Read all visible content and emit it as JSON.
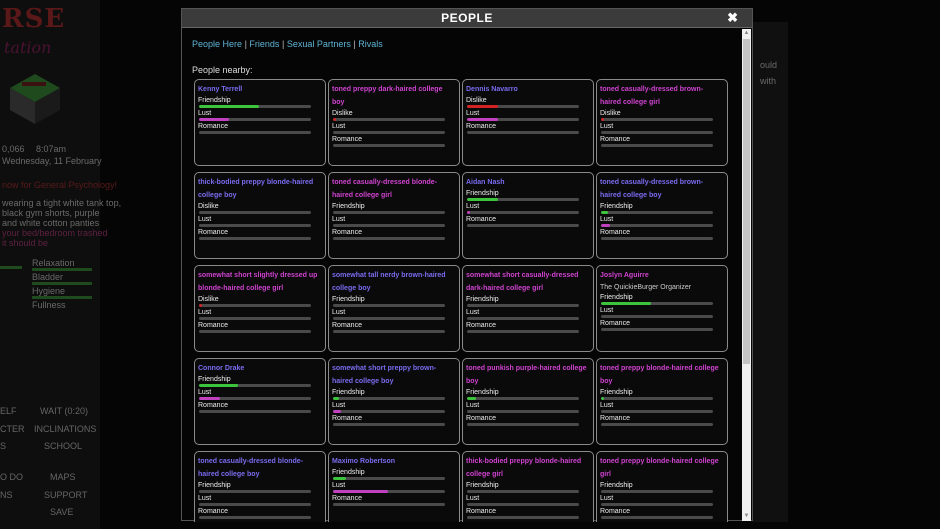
{
  "background": {
    "game_title": "RSE",
    "game_subtitle": "tation",
    "stats_left": [
      "0,066",
      "8:07am",
      "Wednesday, 11 February"
    ],
    "class_text": "now for General Psychology!",
    "outfit_text": [
      "wearing a tight white tank top,",
      "black gym shorts, purple",
      "and white cotton panties"
    ],
    "pink_text": [
      "your bed/bedroom trashed",
      "it should be"
    ],
    "side_labels": [
      "Relaxation",
      "Bladder",
      "Hygiene",
      "Fullness"
    ],
    "menu_items": [
      "ELF",
      "WAIT (0:20)",
      "CTER",
      "INCLINATIONS",
      "S",
      "SCHOOL",
      "O DO",
      "MAPS",
      "NS",
      "SUPPORT",
      "SAVE"
    ],
    "right_text": [
      "ould",
      "with"
    ]
  },
  "modal": {
    "title": "PEOPLE",
    "close_label": "✖",
    "tabs": [
      "People Here",
      "Friends",
      "Sexual Partners",
      "Rivals"
    ],
    "tab_separator": "|",
    "nearby_label": "People nearby:"
  },
  "colors": {
    "friendship": "#3cc43c",
    "dislike": "#d22222",
    "lust": "#c040c0",
    "romance": "#9a9a9a",
    "male_name": "#7a6cf0",
    "female_name": "#d043d0",
    "link": "#5fb4d6"
  },
  "people": [
    {
      "name": "Kenny Terrell",
      "gender": "m",
      "stats": [
        {
          "label": "Friendship",
          "type": "friendship",
          "value": 0.54
        },
        {
          "label": "Lust",
          "type": "lust",
          "value": 0.27
        },
        {
          "label": "Romance",
          "type": "romance",
          "value": 0
        }
      ]
    },
    {
      "name": "toned preppy dark-haired college boy",
      "gender": "f",
      "stats": [
        {
          "label": "Dislike",
          "type": "dislike",
          "value": 0.03
        },
        {
          "label": "Lust",
          "type": "lust",
          "value": 0
        },
        {
          "label": "Romance",
          "type": "romance",
          "value": 0
        }
      ]
    },
    {
      "name": "Dennis Navarro",
      "gender": "m",
      "stats": [
        {
          "label": "Dislike",
          "type": "dislike",
          "value": 0.28
        },
        {
          "label": "Lust",
          "type": "lust",
          "value": 0.28
        },
        {
          "label": "Romance",
          "type": "romance",
          "value": 0
        }
      ]
    },
    {
      "name": "toned casually-dressed brown-haired college girl",
      "gender": "f",
      "stats": [
        {
          "label": "Dislike",
          "type": "dislike",
          "value": 0.03
        },
        {
          "label": "Lust",
          "type": "lust",
          "value": 0
        },
        {
          "label": "Romance",
          "type": "romance",
          "value": 0
        }
      ]
    },
    {
      "name": "thick-bodied preppy blonde-haired college boy",
      "gender": "m",
      "stats": [
        {
          "label": "Dislike",
          "type": "dislike",
          "value": 0
        },
        {
          "label": "Lust",
          "type": "lust",
          "value": 0
        },
        {
          "label": "Romance",
          "type": "romance",
          "value": 0
        }
      ]
    },
    {
      "name": "toned casually-dressed blonde-haired college girl",
      "gender": "f",
      "stats": [
        {
          "label": "Friendship",
          "type": "friendship",
          "value": 0
        },
        {
          "label": "Lust",
          "type": "lust",
          "value": 0
        },
        {
          "label": "Romance",
          "type": "romance",
          "value": 0
        }
      ]
    },
    {
      "name": "Aidan Nash",
      "gender": "m",
      "stats": [
        {
          "label": "Friendship",
          "type": "friendship",
          "value": 0.28
        },
        {
          "label": "Lust",
          "type": "lust",
          "value": 0.03
        },
        {
          "label": "Romance",
          "type": "romance",
          "value": 0
        }
      ]
    },
    {
      "name": "toned casually-dressed brown-haired college boy",
      "gender": "m",
      "stats": [
        {
          "label": "Friendship",
          "type": "friendship",
          "value": 0.06
        },
        {
          "label": "Lust",
          "type": "lust",
          "value": 0.08
        },
        {
          "label": "Romance",
          "type": "romance",
          "value": 0
        }
      ]
    },
    {
      "name": "somewhat short slightly dressed up blonde-haired college girl",
      "gender": "f",
      "stats": [
        {
          "label": "Dislike",
          "type": "dislike",
          "value": 0.03
        },
        {
          "label": "Lust",
          "type": "lust",
          "value": 0
        },
        {
          "label": "Romance",
          "type": "romance",
          "value": 0
        }
      ]
    },
    {
      "name": "somewhat tall nerdy brown-haired college boy",
      "gender": "m",
      "stats": [
        {
          "label": "Friendship",
          "type": "friendship",
          "value": 0
        },
        {
          "label": "Lust",
          "type": "lust",
          "value": 0
        },
        {
          "label": "Romance",
          "type": "romance",
          "value": 0
        }
      ]
    },
    {
      "name": "somewhat short casually-dressed dark-haired college girl",
      "gender": "f",
      "stats": [
        {
          "label": "Friendship",
          "type": "friendship",
          "value": 0
        },
        {
          "label": "Lust",
          "type": "lust",
          "value": 0
        },
        {
          "label": "Romance",
          "type": "romance",
          "value": 0
        }
      ]
    },
    {
      "name": "Joslyn Aguirre",
      "gender": "f",
      "job": "The QuickieBurger Organizer",
      "stats": [
        {
          "label": "Friendship",
          "type": "friendship",
          "value": 0.45
        },
        {
          "label": "Lust",
          "type": "lust",
          "value": 0
        },
        {
          "label": "Romance",
          "type": "romance",
          "value": 0
        }
      ]
    },
    {
      "name": "Connor Drake",
      "gender": "m",
      "stats": [
        {
          "label": "Friendship",
          "type": "friendship",
          "value": 0.35
        },
        {
          "label": "Lust",
          "type": "lust",
          "value": 0.19
        },
        {
          "label": "Romance",
          "type": "romance",
          "value": 0
        }
      ]
    },
    {
      "name": "somewhat short preppy brown-haired college boy",
      "gender": "m",
      "stats": [
        {
          "label": "Friendship",
          "type": "friendship",
          "value": 0.05
        },
        {
          "label": "Lust",
          "type": "lust",
          "value": 0.07
        },
        {
          "label": "Romance",
          "type": "romance",
          "value": 0
        }
      ]
    },
    {
      "name": "toned punkish purple-haired college boy",
      "gender": "f",
      "stats": [
        {
          "label": "Friendship",
          "type": "friendship",
          "value": 0.08
        },
        {
          "label": "Lust",
          "type": "lust",
          "value": 0
        },
        {
          "label": "Romance",
          "type": "romance",
          "value": 0
        }
      ]
    },
    {
      "name": "toned preppy blonde-haired college boy",
      "gender": "f",
      "stats": [
        {
          "label": "Friendship",
          "type": "friendship",
          "value": 0.03
        },
        {
          "label": "Lust",
          "type": "lust",
          "value": 0
        },
        {
          "label": "Romance",
          "type": "romance",
          "value": 0
        }
      ]
    },
    {
      "name": "toned casually-dressed blonde-haired college boy",
      "gender": "m",
      "stats": [
        {
          "label": "Friendship",
          "type": "friendship",
          "value": 0
        },
        {
          "label": "Lust",
          "type": "lust",
          "value": 0
        },
        {
          "label": "Romance",
          "type": "romance",
          "value": 0
        }
      ]
    },
    {
      "name": "Maximo Robertson",
      "gender": "m",
      "stats": [
        {
          "label": "Friendship",
          "type": "friendship",
          "value": 0.12
        },
        {
          "label": "Lust",
          "type": "lust",
          "value": 0.49
        },
        {
          "label": "Romance",
          "type": "romance",
          "value": 0
        }
      ]
    },
    {
      "name": "thick-bodied preppy blonde-haired college girl",
      "gender": "f",
      "stats": [
        {
          "label": "Friendship",
          "type": "friendship",
          "value": 0
        },
        {
          "label": "Lust",
          "type": "lust",
          "value": 0
        },
        {
          "label": "Romance",
          "type": "romance",
          "value": 0
        }
      ]
    },
    {
      "name": "toned preppy blonde-haired college girl",
      "gender": "f",
      "stats": [
        {
          "label": "Friendship",
          "type": "friendship",
          "value": 0
        },
        {
          "label": "Lust",
          "type": "lust",
          "value": 0
        },
        {
          "label": "Romance",
          "type": "romance",
          "value": 0
        }
      ]
    }
  ]
}
